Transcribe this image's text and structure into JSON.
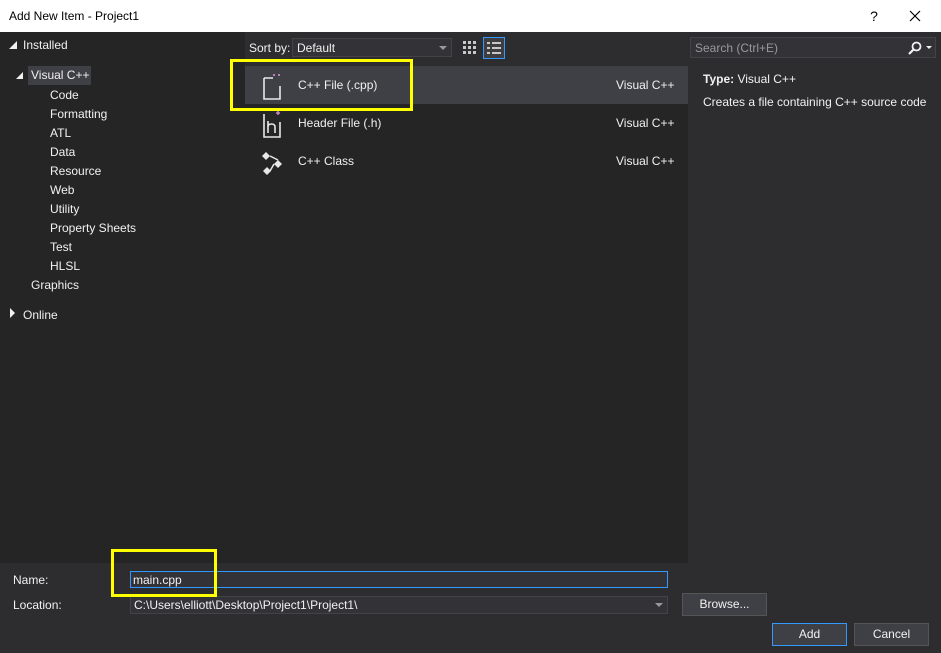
{
  "window": {
    "title": "Add New Item - Project1",
    "help_label": "?"
  },
  "tree": {
    "installed_label": "Installed",
    "visual_cpp_label": "Visual C++",
    "children": [
      "Code",
      "Formatting",
      "ATL",
      "Data",
      "Resource",
      "Web",
      "Utility",
      "Property Sheets",
      "Test",
      "HLSL"
    ],
    "graphics_label": "Graphics",
    "online_label": "Online"
  },
  "toolbar": {
    "sort_label": "Sort by:",
    "sort_value": "Default"
  },
  "search": {
    "placeholder": "Search (Ctrl+E)"
  },
  "items": [
    {
      "name": "C++ File (.cpp)",
      "lang": "Visual C++"
    },
    {
      "name": "Header File (.h)",
      "lang": "Visual C++"
    },
    {
      "name": "C++ Class",
      "lang": "Visual C++"
    }
  ],
  "description": {
    "type_label": "Type:",
    "type_value": "Visual C++",
    "text": "Creates a file containing C++ source code"
  },
  "bottom": {
    "name_label": "Name:",
    "name_value": "main.cpp",
    "location_label": "Location:",
    "location_value": "C:\\Users\\elliott\\Desktop\\Project1\\Project1\\",
    "browse_label": "Browse...",
    "add_label": "Add",
    "cancel_label": "Cancel"
  },
  "colors": {
    "highlight": "#ffff00",
    "accent": "#3399ff",
    "icon_plus": "#c586c0"
  }
}
